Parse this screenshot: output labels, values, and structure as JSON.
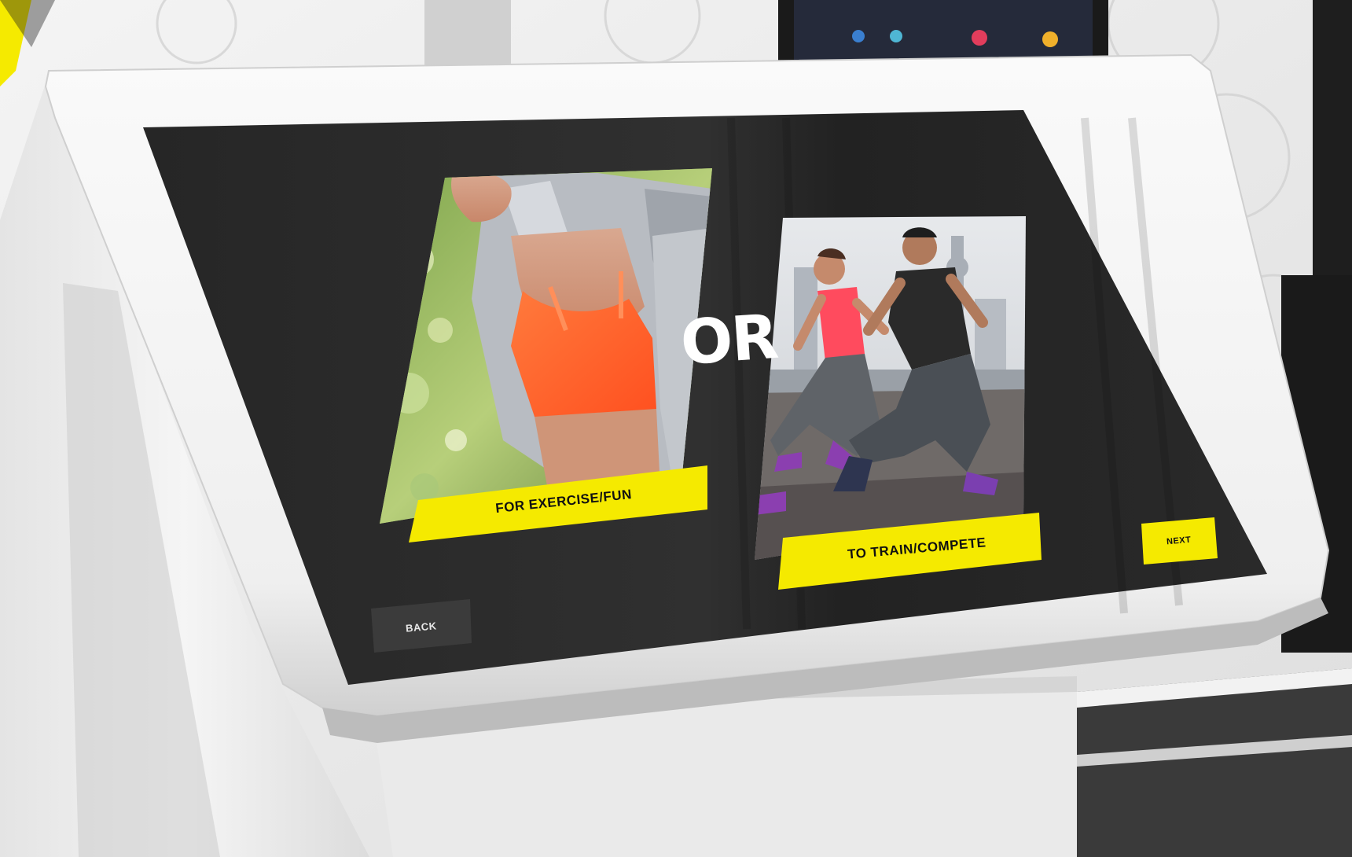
{
  "kiosk": {
    "choice_left": {
      "label": "FOR EXERCISE/FUN",
      "image": "woman-in-orange-sports-bra-and-grey-jacket"
    },
    "divider_text": "OR",
    "choice_right": {
      "label": "TO TRAIN/COMPETE",
      "image": "two-runners-sprinting-in-city"
    },
    "back_label": "BACK",
    "next_label": "NEXT"
  },
  "colors": {
    "accent_yellow": "#f5ea00",
    "screen_bg": "#2a2a2a",
    "back_button": "#3b3b3b",
    "bezel": "#f3f3f3"
  }
}
